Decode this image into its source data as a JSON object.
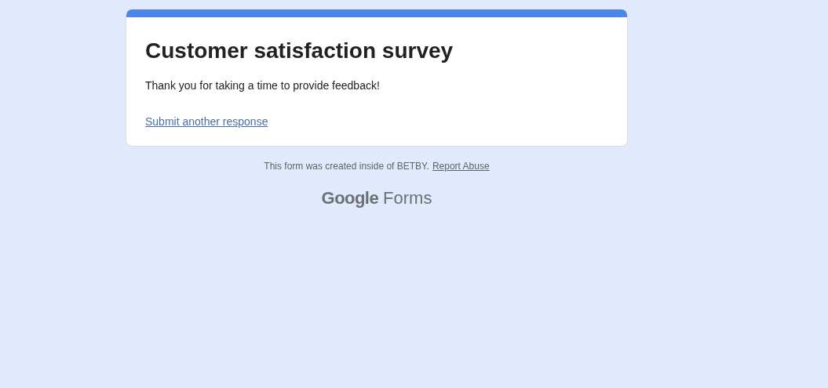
{
  "card": {
    "title": "Customer satisfaction survey",
    "message": "Thank you for taking a time to provide feedback!",
    "link": "Submit another response"
  },
  "footer": {
    "notice": "This form was created inside of BETBY.",
    "link": "Report Abuse"
  },
  "logo": {
    "brand": "Google",
    "product": "Forms"
  }
}
